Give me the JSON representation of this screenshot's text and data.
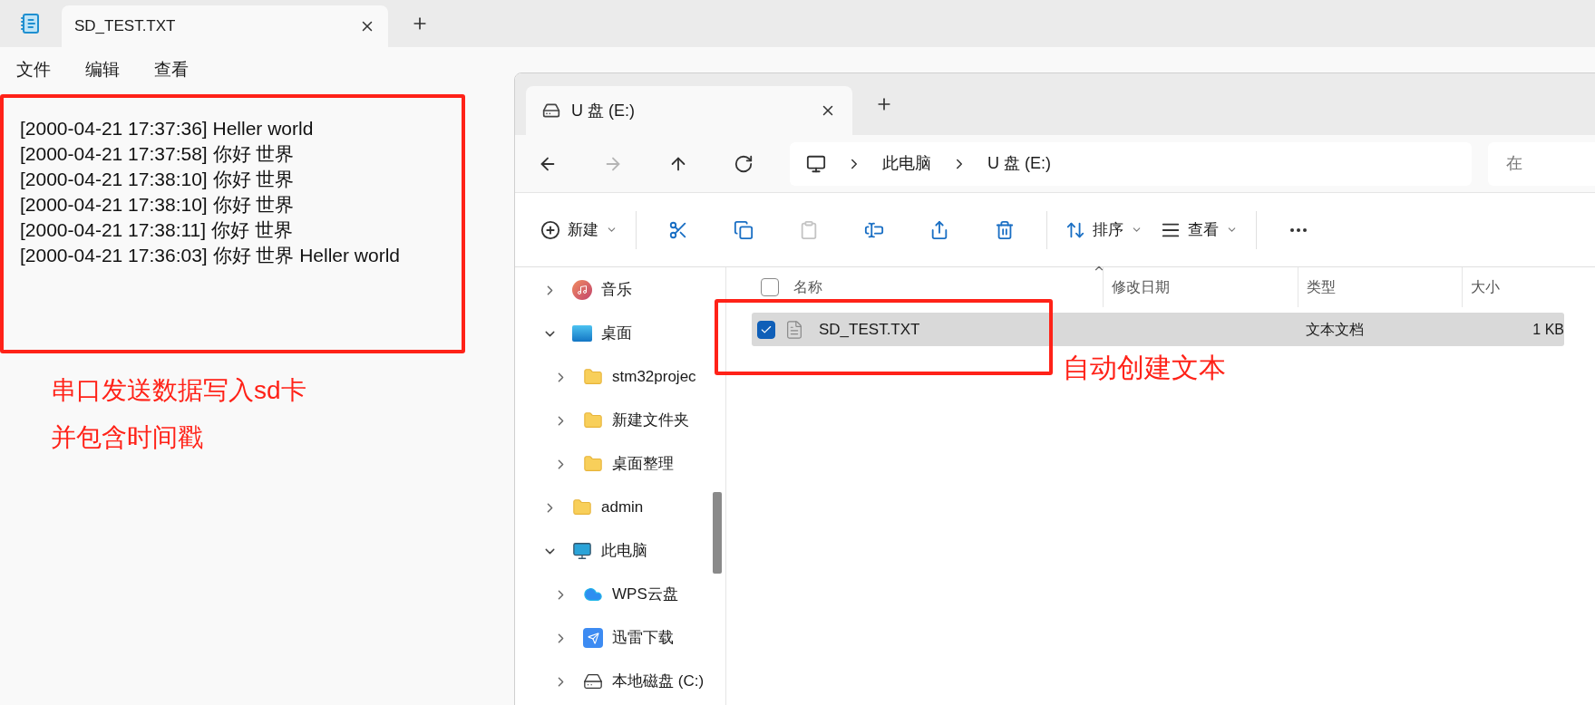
{
  "notepad": {
    "tab_title": "SD_TEST.TXT",
    "menu": [
      "文件",
      "编辑",
      "查看"
    ],
    "lines": [
      "[2000-04-21 17:37:36] Heller world",
      "[2000-04-21 17:37:58] 你好 世界",
      "[2000-04-21 17:38:10] 你好 世界",
      "[2000-04-21 17:38:10] 你好 世界",
      "[2000-04-21 17:38:11] 你好 世界",
      "[2000-04-21 17:36:03] 你好 世界 Heller world"
    ]
  },
  "explorer": {
    "tab_title": "U 盘 (E:)",
    "nav": [
      {
        "kind": "back",
        "disabled": false
      },
      {
        "kind": "forward",
        "disabled": true
      },
      {
        "kind": "up",
        "disabled": false
      },
      {
        "kind": "refresh",
        "disabled": false
      }
    ],
    "breadcrumb": [
      "此电脑",
      "U 盘 (E:)"
    ],
    "search_placeholder": "在",
    "toolbar": [
      {
        "kind": "new",
        "label": "新建",
        "disabled": false
      },
      {
        "kind": "cut",
        "disabled": false
      },
      {
        "kind": "copy",
        "disabled": false
      },
      {
        "kind": "paste",
        "disabled": true
      },
      {
        "kind": "rename",
        "disabled": false
      },
      {
        "kind": "share",
        "disabled": false
      },
      {
        "kind": "delete",
        "disabled": false
      },
      {
        "kind": "sort",
        "label": "排序",
        "disabled": false
      },
      {
        "kind": "view",
        "label": "查看",
        "disabled": false
      },
      {
        "kind": "more",
        "disabled": false
      }
    ],
    "sidebar": [
      {
        "kind": "music",
        "label": "音乐",
        "expanded": false
      },
      {
        "kind": "desktop",
        "label": "桌面",
        "expanded": true,
        "children": [
          {
            "kind": "folder",
            "label": "stm32projec",
            "expanded": false
          },
          {
            "kind": "folder",
            "label": "新建文件夹",
            "expanded": false
          },
          {
            "kind": "folder",
            "label": "桌面整理",
            "expanded": false
          }
        ]
      },
      {
        "kind": "folder",
        "label": "admin",
        "expanded": false
      },
      {
        "kind": "pc",
        "label": "此电脑",
        "expanded": true,
        "children": [
          {
            "kind": "cloud",
            "label": "WPS云盘",
            "expanded": false
          },
          {
            "kind": "app",
            "label": "迅雷下载",
            "expanded": false
          },
          {
            "kind": "drive",
            "label": "本地磁盘 (C:)",
            "expanded": false
          }
        ]
      }
    ],
    "columns": [
      "名称",
      "修改日期",
      "类型",
      "大小"
    ],
    "header_checked": false,
    "files": [
      {
        "name": "SD_TEST.TXT",
        "type": "文本文档",
        "size": "1 KB",
        "selected": true,
        "checked": true
      }
    ]
  },
  "annotations": [
    {
      "text": "串口发送数据写入sd卡"
    },
    {
      "text": "并包含时间戳"
    },
    {
      "text": "自动创建文本"
    }
  ]
}
